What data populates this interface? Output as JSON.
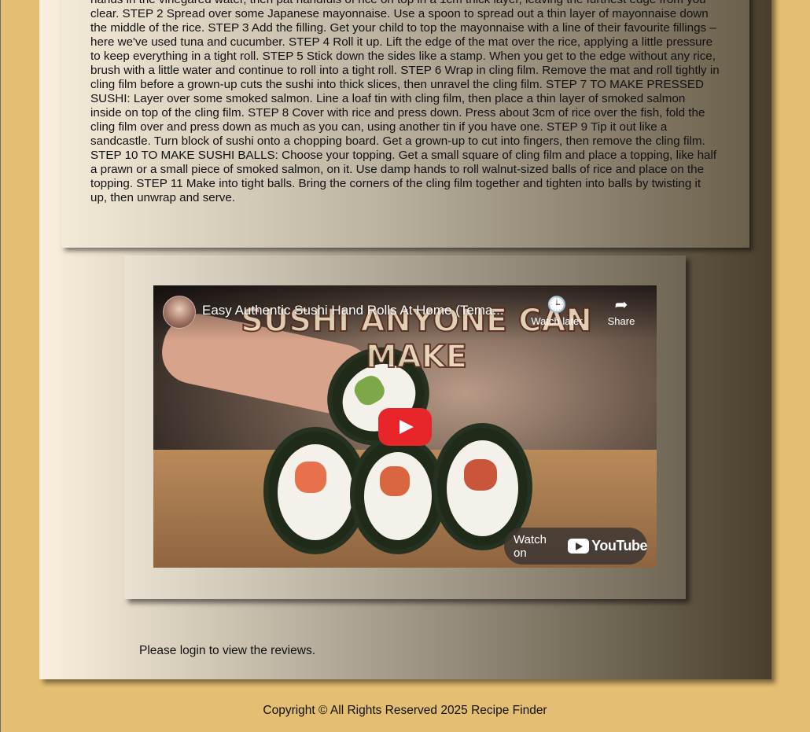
{
  "instructions": {
    "text": "hands in the vinegared water, then pat handfuls of rice on top in a 1cm thick layer, leaving the furthest edge from you clear. STEP 2 Spread over some Japanese mayonnaise. Use a spoon to spread out a thin layer of mayonnaise down the middle of the rice. STEP 3 Add the filling. Get your child to top the mayonnaise with a line of their favourite fillings – here we've used tuna and cucumber. STEP 4 Roll it up. Lift the edge of the mat over the rice, applying a little pressure to keep everything in a tight roll. STEP 5 Stick down the sides like a stamp. When you get to the edge without any rice, brush with a little water and continue to roll into a tight roll. STEP 6 Wrap in cling film. Remove the mat and roll tightly in cling film before a grown-up cuts the sushi into thick slices, then unravel the cling film. STEP 7 TO MAKE PRESSED SUSHI: Layer over some smoked salmon. Line a loaf tin with cling film, then place a thin layer of smoked salmon inside on top of the cling film. STEP 8 Cover with rice and press down. Press about 3cm of rice over the fish, fold the cling film over and press down as much as you can, using another tin if you have one. STEP 9 Tip it out like a sandcastle. Turn block of sushi onto a chopping board. Get a grown-up to cut into fingers, then remove the cling film. STEP 10 TO MAKE SUSHI BALLS: Choose your topping. Get a small square of cling film and place a topping, like half a prawn or a small piece of smoked salmon, on it. Use damp hands to roll walnut-sized balls of rice and place on the topping. STEP 11 Make into tight balls. Bring the corners of the cling film together and tighten into balls by twisting it up, then unwrap and serve."
  },
  "video": {
    "title": "Easy Authentic Sushi Hand Rolls At Home (Tema...",
    "thumbnail_caption": "SUSHI ANYONE CAN MAKE",
    "watch_later_label": "Watch later",
    "share_label": "Share",
    "watch_on_label": "Watch on",
    "youtube_wordmark": "YouTube",
    "play_color": "#e8262a"
  },
  "reviews": {
    "message": "Please login to view the reviews."
  },
  "footer": {
    "copyright": "Copyright © All Rights Reserved 2025 Recipe Finder"
  },
  "colors": {
    "page_background": "#e4be72",
    "panel_gradient_start": "#fbf0dd",
    "panel_gradient_end": "#4a3f2d"
  }
}
